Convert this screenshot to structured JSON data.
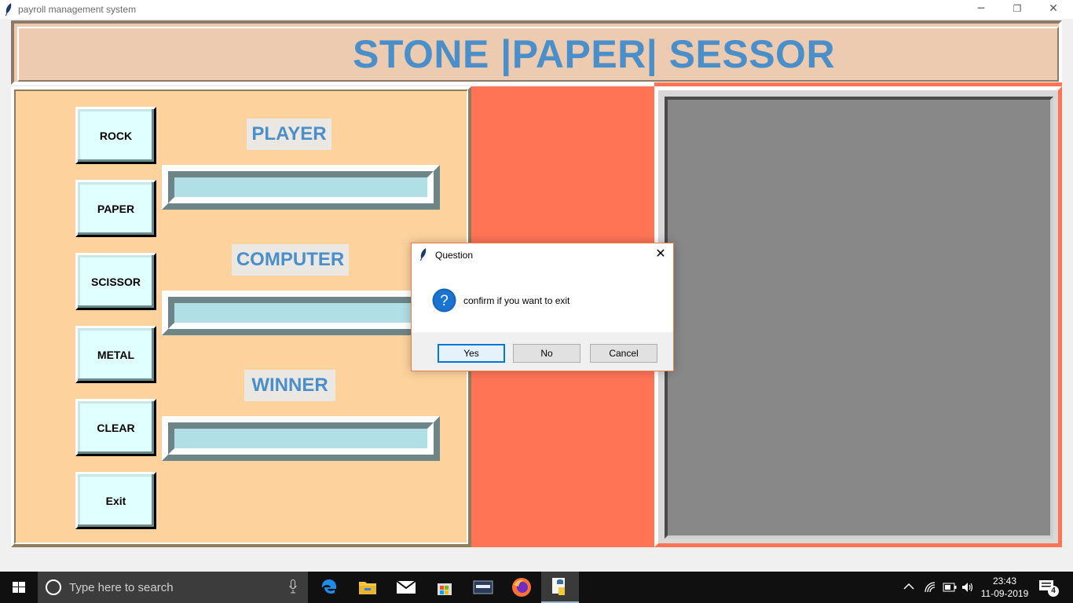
{
  "window": {
    "title": "payroll management system",
    "controls": {
      "minimize": "─",
      "restore": "❐",
      "close": "✕"
    }
  },
  "header": {
    "title": "STONE |PAPER| SESSOR"
  },
  "buttons": [
    {
      "label": "ROCK"
    },
    {
      "label": "PAPER"
    },
    {
      "label": "SCISSOR"
    },
    {
      "label": "METAL"
    },
    {
      "label": "CLEAR"
    },
    {
      "label": "Exit"
    }
  ],
  "labels": {
    "player": "PLAYER",
    "computer": "COMPUTER",
    "winner": "WINNER"
  },
  "entries": {
    "player": "",
    "computer": "",
    "winner": ""
  },
  "dialog": {
    "title": "Question",
    "icon": "question-icon",
    "message": "confirm if you want to exit",
    "close": "✕",
    "buttons": {
      "yes": "Yes",
      "no": "No",
      "cancel": "Cancel"
    }
  },
  "taskbar": {
    "search_placeholder": "Type here to search",
    "apps": [
      "edge-icon",
      "file-explorer-icon",
      "mail-icon",
      "store-icon",
      "mysql-icon",
      "firefox-icon",
      "python-icon"
    ],
    "clock_time": "23:43",
    "clock_date": "11-09-2019",
    "notification_count": "4"
  },
  "colors": {
    "header_bg": "#eccbb0",
    "title_blue": "#4a8fca",
    "left_panel_bg": "#fdd29d",
    "middle_bg": "#ff7455",
    "button_bg": "#e0ffff",
    "entry_bg": "#b0e0e6",
    "canvas_gray": "#888888"
  }
}
